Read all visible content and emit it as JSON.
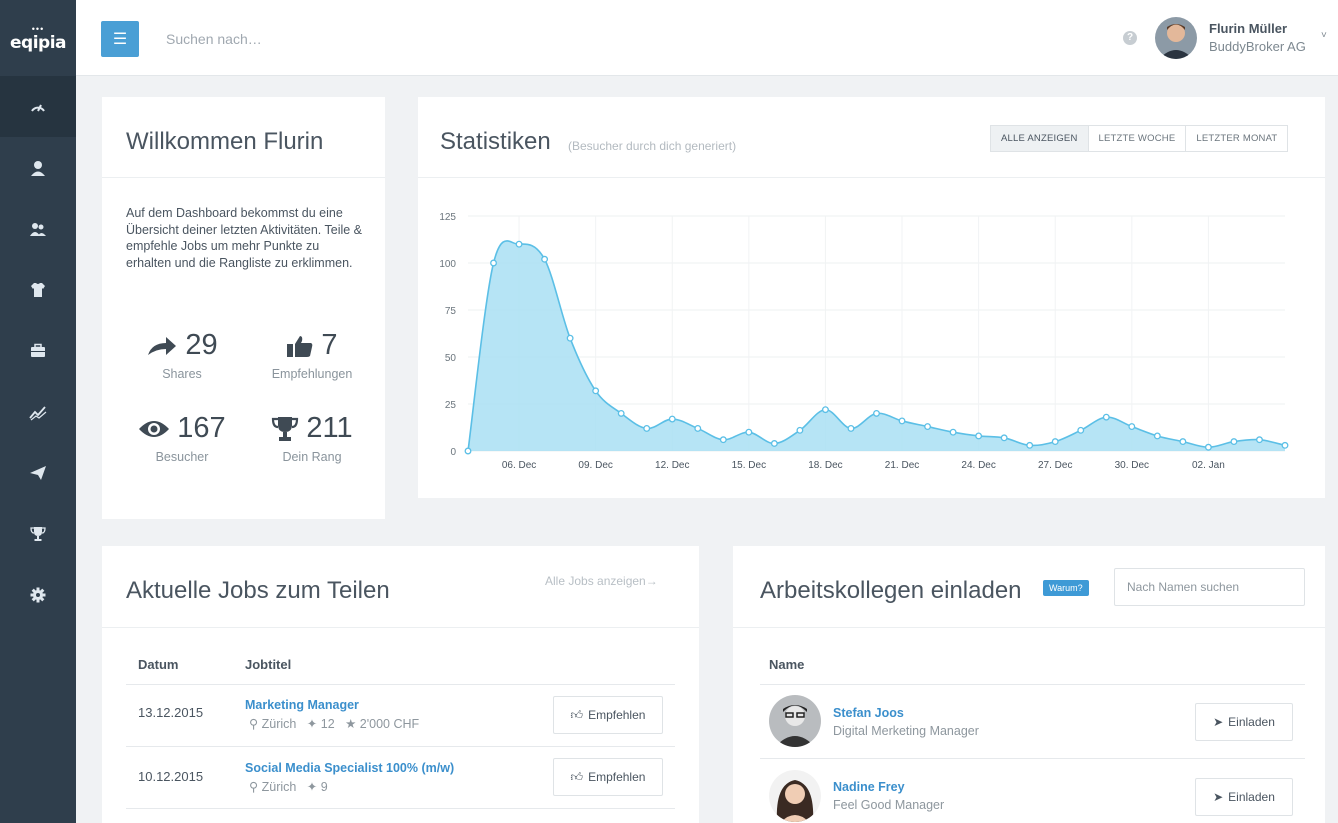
{
  "brand": {
    "logo_text": "eqipia",
    "logo_people": "•••"
  },
  "sidebar": {
    "items": [
      {
        "icon": "dashboard-icon",
        "active": true
      },
      {
        "icon": "user-icon"
      },
      {
        "icon": "users-icon"
      },
      {
        "icon": "shirt-icon"
      },
      {
        "icon": "briefcase-icon"
      },
      {
        "icon": "trend-icon"
      },
      {
        "icon": "send-icon"
      },
      {
        "icon": "trophy-icon"
      },
      {
        "icon": "gear-icon"
      }
    ]
  },
  "topbar": {
    "search_placeholder": "Suchen nach…",
    "help": "?",
    "user_name": "Flurin Müller",
    "user_company": "BuddyBroker AG",
    "chevron": "˅"
  },
  "welcome": {
    "title": "Willkommen Flurin",
    "text": "Auf dem Dashboard bekommst du eine Übersicht deiner letzten Aktivitäten. Teile & empfehle Jobs um mehr Punkte zu erhalten und die Rangliste zu erklimmen.",
    "stats": [
      {
        "value": "29",
        "label": "Shares",
        "icon": "share-arrow-icon"
      },
      {
        "value": "7",
        "label": "Empfehlungen",
        "icon": "thumbs-up-icon"
      },
      {
        "value": "167",
        "label": "Besucher",
        "icon": "eye-icon"
      },
      {
        "value": "211",
        "label": "Dein Rang",
        "icon": "trophy-icon"
      }
    ]
  },
  "stats": {
    "title": "Statistiken",
    "subtitle": "(Besucher durch dich generiert)",
    "filters": [
      "ALLE ANZEIGEN",
      "LETZTE WOCHE",
      "LETZTER MONAT"
    ]
  },
  "chart_data": {
    "type": "area",
    "x": [
      "04. Dec",
      "05. Dec",
      "06. Dec",
      "07. Dec",
      "08. Dec",
      "09. Dec",
      "10. Dec",
      "11. Dec",
      "12. Dec",
      "13. Dec",
      "14. Dec",
      "15. Dec",
      "16. Dec",
      "17. Dec",
      "18. Dec",
      "19. Dec",
      "20. Dec",
      "21. Dec",
      "22. Dec",
      "23. Dec",
      "24. Dec",
      "25. Dec",
      "26. Dec",
      "27. Dec",
      "28. Dec",
      "29. Dec",
      "30. Dec",
      "31. Dec",
      "01. Jan",
      "02. Jan",
      "03. Jan",
      "04. Jan"
    ],
    "values": [
      0,
      100,
      110,
      102,
      60,
      32,
      20,
      12,
      17,
      12,
      6,
      10,
      4,
      11,
      22,
      12,
      20,
      16,
      13,
      10,
      8,
      7,
      3,
      5,
      11,
      18,
      13,
      8,
      5,
      2,
      5,
      6,
      3
    ],
    "x_ticks": [
      "06. Dec",
      "09. Dec",
      "12. Dec",
      "15. Dec",
      "18. Dec",
      "21. Dec",
      "24. Dec",
      "27. Dec",
      "30. Dec",
      "02. Jan"
    ],
    "y_ticks": [
      0,
      25,
      50,
      75,
      100,
      125
    ],
    "ylim": [
      0,
      125
    ],
    "color": "#5bbfe6",
    "fill": "#a9dff3",
    "grid": true
  },
  "jobs": {
    "title": "Aktuelle Jobs zum Teilen",
    "all_link": "Alle Jobs anzeigen→",
    "columns": [
      "Datum",
      "Jobtitel"
    ],
    "rows": [
      {
        "date": "13.12.2015",
        "title": "Marketing Manager",
        "location": "Zürich",
        "people": "12",
        "reward": "2'000 CHF",
        "button": "Empfehlen"
      },
      {
        "date": "10.12.2015",
        "title": "Social Media Specialist 100% (m/w)",
        "location": "Zürich",
        "people": "9",
        "reward": "",
        "button": "Empfehlen"
      }
    ]
  },
  "colleagues": {
    "title": "Arbeitskollegen einladen",
    "badge": "Warum?",
    "search_placeholder": "Nach Namen suchen",
    "column": "Name",
    "people": [
      {
        "name": "Stefan Joos",
        "role": "Digital Merketing Manager",
        "button": "Einladen"
      },
      {
        "name": "Nadine Frey",
        "role": "Feel Good Manager",
        "button": "Einladen"
      }
    ]
  }
}
